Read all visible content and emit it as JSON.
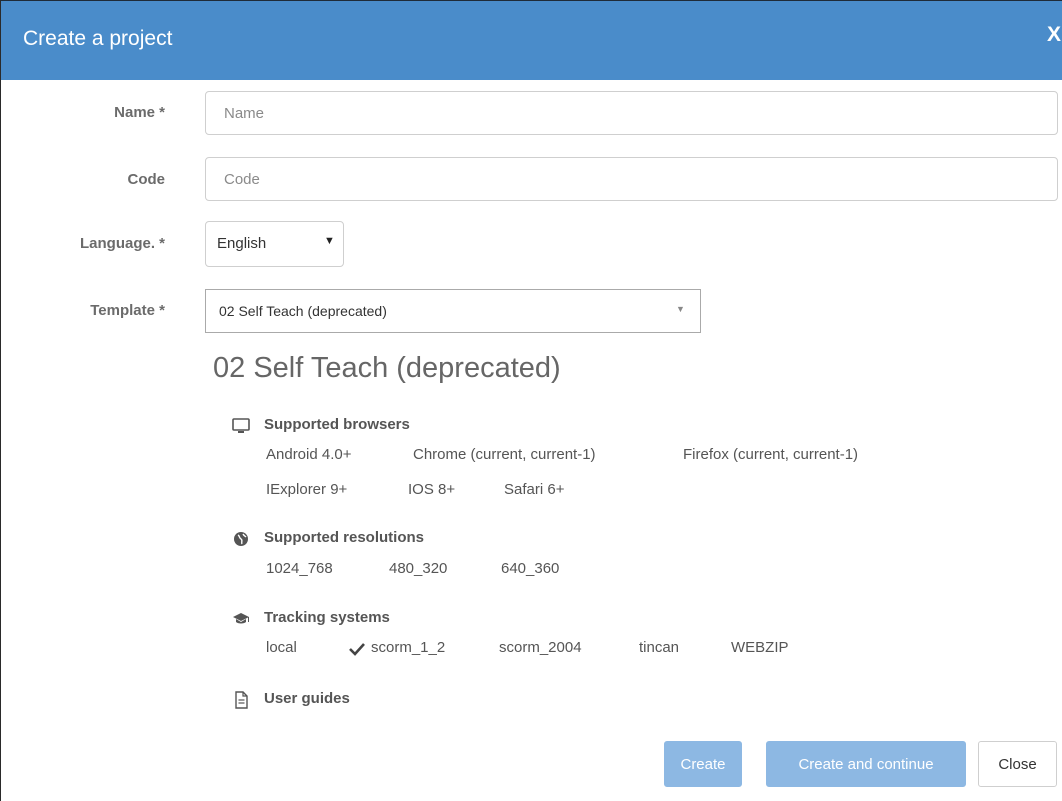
{
  "dialog": {
    "title": "Create a project",
    "close_glyph": "X"
  },
  "form": {
    "name": {
      "label": "Name *",
      "placeholder": "Name",
      "value": ""
    },
    "code": {
      "label": "Code",
      "placeholder": "Code",
      "value": ""
    },
    "language": {
      "label": "Language. *",
      "selected": "English"
    },
    "template": {
      "label": "Template *",
      "selected": "02 Self Teach (deprecated)"
    }
  },
  "template_details": {
    "heading": "02 Self Teach (deprecated)",
    "supported_browsers": {
      "title": "Supported browsers",
      "icon": "monitor-icon",
      "items": [
        "Android 4.0+",
        "Chrome (current, current-1)",
        "Firefox (current, current-1)",
        "IExplorer 9+",
        "IOS 8+",
        "Safari 6+"
      ]
    },
    "supported_resolutions": {
      "title": "Supported resolutions",
      "icon": "globe-icon",
      "items": [
        "1024_768",
        "480_320",
        "640_360"
      ]
    },
    "tracking_systems": {
      "title": "Tracking systems",
      "icon": "graduation-cap-icon",
      "items": [
        "local",
        "scorm_1_2",
        "scorm_2004",
        "tincan",
        "WEBZIP"
      ],
      "checked": "scorm_1_2"
    },
    "user_guides": {
      "title": "User guides",
      "icon": "document-icon"
    }
  },
  "buttons": {
    "create": "Create",
    "create_continue": "Create and continue",
    "close": "Close"
  },
  "colors": {
    "header_bg": "#4a8cca",
    "primary_button": "#8db8e3"
  }
}
